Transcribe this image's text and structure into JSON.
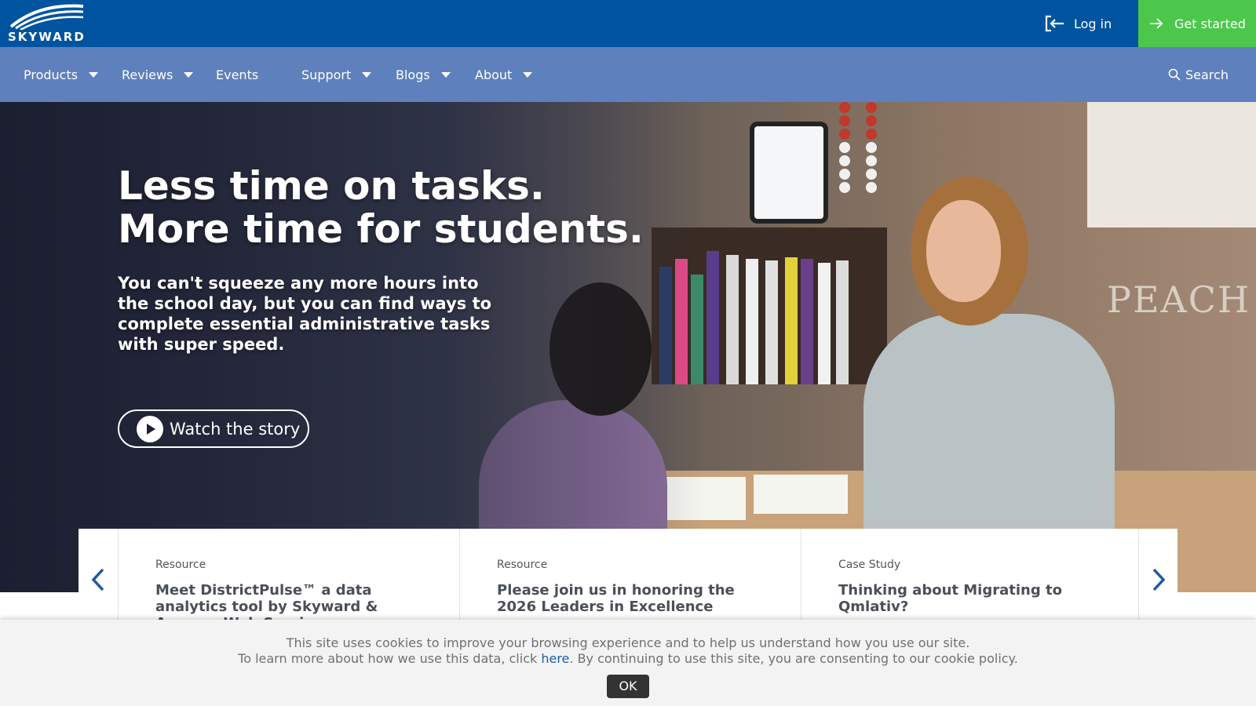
{
  "header": {
    "logo_text": "SKYWARD",
    "login_label": "Log in",
    "get_started_label": "Get started"
  },
  "nav": {
    "items": [
      {
        "label": "Products",
        "has_dropdown": true
      },
      {
        "label": "Reviews",
        "has_dropdown": true
      },
      {
        "label": "Events",
        "has_dropdown": false
      },
      {
        "label": "Support",
        "has_dropdown": true
      },
      {
        "label": "Blogs",
        "has_dropdown": true
      },
      {
        "label": "About",
        "has_dropdown": true
      }
    ],
    "search_label": "Search"
  },
  "hero": {
    "headline_line1": "Less time on tasks.",
    "headline_line2": "More time for students.",
    "subtext": "You can't squeeze any more hours into the school day, but you can find ways to complete essential administrative tasks with super speed.",
    "cta_label": "Watch the story",
    "sign_text": "PEACH"
  },
  "cards": [
    {
      "type": "Resource",
      "title": "Meet DistrictPulse™ a data analytics tool by Skyward & Amazon Web Services"
    },
    {
      "type": "Resource",
      "title": "Please join us in honoring the 2026 Leaders in Excellence"
    },
    {
      "type": "Case Study",
      "title": "Thinking about Migrating to Qmlativ?"
    }
  ],
  "cookie": {
    "line1": "This site uses cookies to improve your browsing experience and to help us understand how you use our site.",
    "line2_before": "To learn more about how we use this data, click",
    "link_label": "here",
    "line2_after": ". By continuing to use this site, you are consenting to our cookie policy.",
    "ok_label": "OK"
  },
  "icons": {
    "login": "login-arrow-icon",
    "get_started": "arrow-right-icon",
    "search": "search-icon",
    "play": "play-icon",
    "prev": "chevron-left-icon",
    "next": "chevron-right-icon"
  },
  "colors": {
    "topbar": "#00549f",
    "nav": "#5e80bd",
    "get_started": "#4cc74c",
    "card_arrow": "#1f5a9e",
    "cookie_link": "#1d60a8"
  }
}
